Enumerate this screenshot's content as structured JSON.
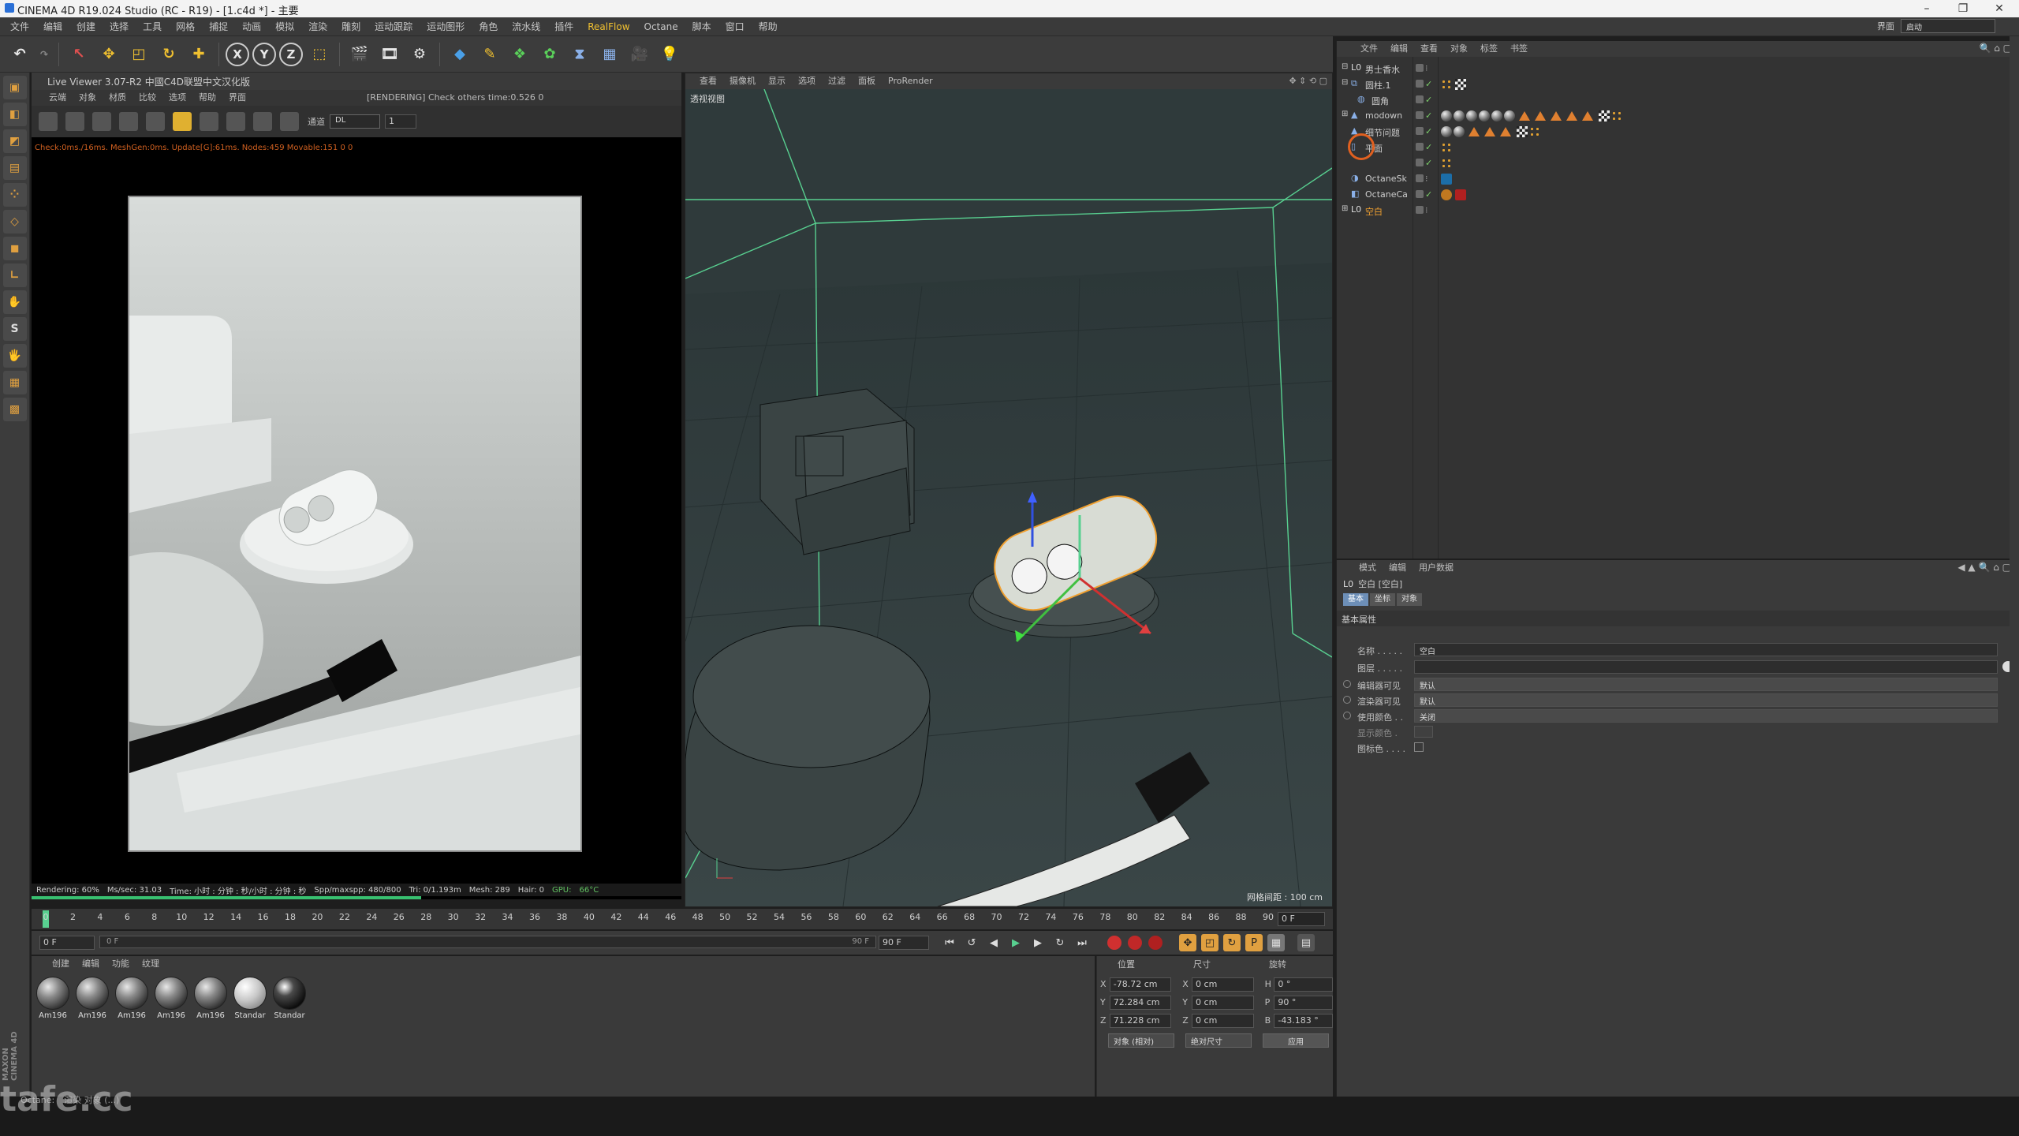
{
  "window": {
    "title": "CINEMA 4D R19.024 Studio (RC - R19) - [1.c4d *] - 主要",
    "controls": [
      "–",
      "❐",
      "✕"
    ]
  },
  "menu": {
    "items": [
      "文件",
      "编辑",
      "创建",
      "选择",
      "工具",
      "网格",
      "捕捉",
      "动画",
      "模拟",
      "渲染",
      "雕刻",
      "运动跟踪",
      "运动图形",
      "角色",
      "流水线",
      "插件",
      "RealFlow",
      "Octane",
      "脚本",
      "窗口",
      "帮助"
    ],
    "layout_label": "界面",
    "layout_value": "启动"
  },
  "live_viewer": {
    "title": "Live Viewer 3.07-R2 中國C4D联盟中文汉化版",
    "menu": [
      "云端",
      "对象",
      "材质",
      "比较",
      "选项",
      "帮助",
      "界面"
    ],
    "status": "[RENDERING] Check others time:0.526  0",
    "channel_label": "通道",
    "channel_value": "DL",
    "channel_number": "1",
    "stats": "Check:0ms./16ms. MeshGen:0ms. Update[G]:61ms. Nodes:459 Movable:151  0 0",
    "footer": {
      "rendering": "Rendering: 60%",
      "ms_sec": "Ms/sec: 31.03",
      "time": "Time: 小时 : 分钟 : 秒/小时 : 分钟 : 秒",
      "spp": "Spp/maxspp: 480/800",
      "tri": "Tri: 0/1.193m",
      "mesh": "Mesh: 289",
      "hair": "Hair: 0",
      "gpu": "GPU:",
      "temp": "66°C"
    },
    "render_progress": 0.6
  },
  "viewport": {
    "menu": [
      "查看",
      "摄像机",
      "显示",
      "选项",
      "过滤",
      "面板",
      "ProRender"
    ],
    "label": "透视视图",
    "grid_spacing": "网格间距 : 100 cm"
  },
  "timeline": {
    "ticks": [
      "0",
      "2",
      "4",
      "6",
      "8",
      "10",
      "12",
      "14",
      "16",
      "18",
      "20",
      "22",
      "24",
      "26",
      "28",
      "30",
      "32",
      "34",
      "36",
      "38",
      "40",
      "42",
      "44",
      "46",
      "48",
      "50",
      "52",
      "54",
      "56",
      "58",
      "60",
      "62",
      "64",
      "66",
      "68",
      "70",
      "72",
      "74",
      "76",
      "78",
      "80",
      "82",
      "84",
      "86",
      "88",
      "90"
    ],
    "current_frame": "0 F",
    "start_frame": "0 F",
    "range_start": "0 F",
    "range_end": "90 F",
    "end_frame": "90 F"
  },
  "materials": {
    "menu": [
      "创建",
      "编辑",
      "功能",
      "纹理"
    ],
    "items": [
      {
        "name": "Am196",
        "style": "mid"
      },
      {
        "name": "Am196",
        "style": "mid"
      },
      {
        "name": "Am196",
        "style": "mid"
      },
      {
        "name": "Am196",
        "style": "mid"
      },
      {
        "name": "Am196",
        "style": "mid"
      },
      {
        "name": "Standar",
        "style": "light"
      },
      {
        "name": "Standar",
        "style": "dark"
      }
    ]
  },
  "coordinates": {
    "headers": [
      "位置",
      "尺寸",
      "旋转"
    ],
    "rows": [
      {
        "axis": "X",
        "pos": "-78.72 cm",
        "size_axis": "X",
        "size": "0 cm",
        "rot_axis": "H",
        "rot": "0 °"
      },
      {
        "axis": "Y",
        "pos": "72.284 cm",
        "size_axis": "Y",
        "size": "0 cm",
        "rot_axis": "P",
        "rot": "90 °"
      },
      {
        "axis": "Z",
        "pos": "71.228 cm",
        "size_axis": "Z",
        "size": "0 cm",
        "rot_axis": "B",
        "rot": "-43.183 °"
      }
    ],
    "mode": "对象 (相对)",
    "size_mode": "绝对尺寸",
    "apply": "应用"
  },
  "object_manager": {
    "menu": [
      "文件",
      "编辑",
      "查看",
      "对象",
      "标签",
      "书签"
    ],
    "objects": [
      {
        "name": "男士香水",
        "selected": false
      },
      {
        "name": "圆柱.1",
        "selected": false
      },
      {
        "name": "圆角",
        "selected": false
      },
      {
        "name": "modown",
        "selected": false
      },
      {
        "name": "细节问题",
        "selected": false
      },
      {
        "name": "平面",
        "selected": false
      },
      {
        "name": "",
        "selected": false
      },
      {
        "name": "OctaneSk",
        "selected": false
      },
      {
        "name": "OctaneCa",
        "selected": false
      },
      {
        "name": "空白",
        "selected": true
      }
    ]
  },
  "attribute_manager": {
    "menu": [
      "模式",
      "编辑",
      "用户数据"
    ],
    "object_title": "空白 [空白]",
    "tabs": [
      "基本",
      "坐标",
      "对象"
    ],
    "section": "基本属性",
    "fields": [
      {
        "label": "名称 . . . . .",
        "value": "空白"
      },
      {
        "label": "图层 . . . . .",
        "value": ""
      },
      {
        "label": "编辑器可见",
        "value": "默认"
      },
      {
        "label": "渲染器可见",
        "value": "默认"
      },
      {
        "label": "使用颜色 . .",
        "value": "关闭"
      },
      {
        "label": "显示颜色 .",
        "value": ""
      },
      {
        "label": "图标色 . . . .",
        "value": ""
      }
    ]
  },
  "status": {
    "octane": "Octane:",
    "message": "渲染 对象 (...)",
    "watermark": "tafe.cc",
    "brand": "MAXON CINEMA 4D"
  },
  "colors": {
    "accent": "#f0a030",
    "selection": "#6d8fb8",
    "viewport_bg": "#2f3a3b",
    "wire_green": "#58d090"
  }
}
